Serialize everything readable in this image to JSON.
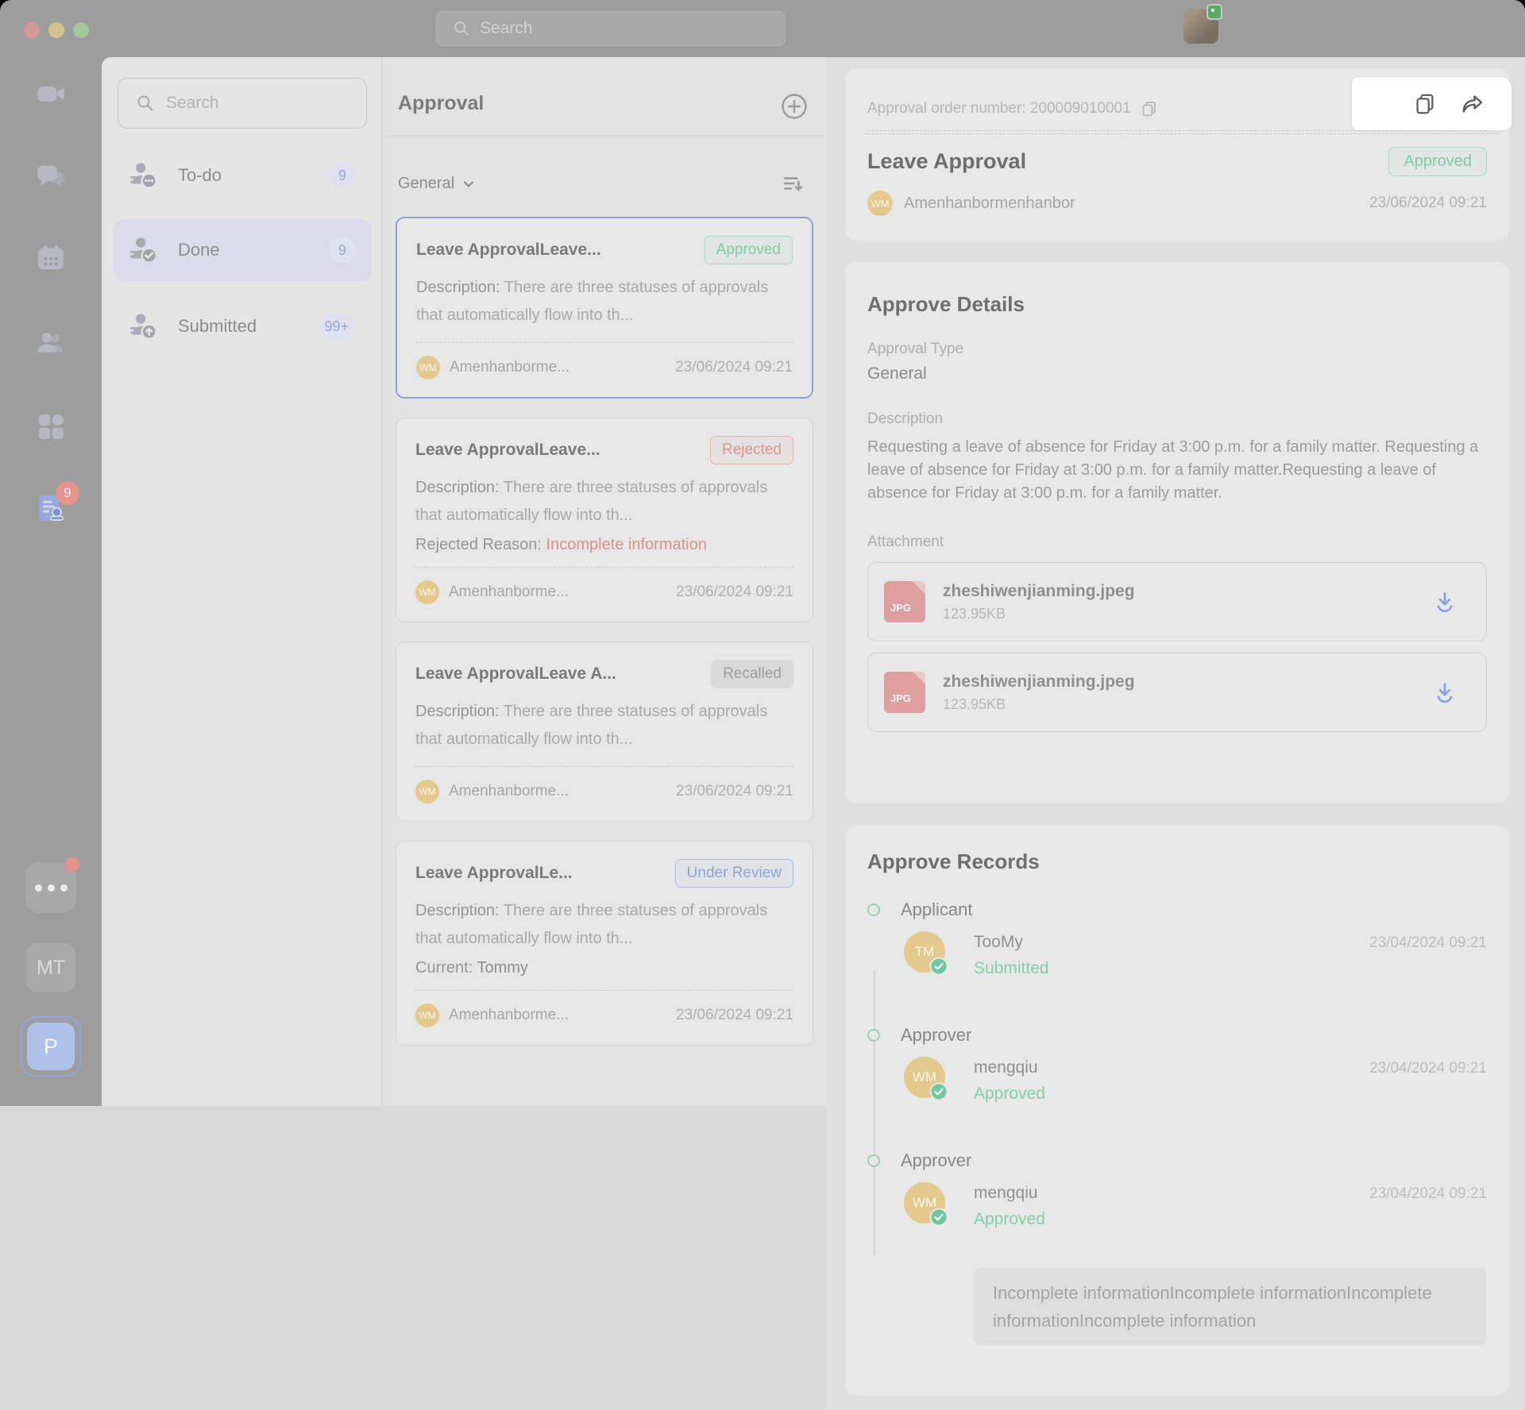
{
  "colors": {
    "status_approved_green": "#7fcda6",
    "status_rejected_red": "#db958e",
    "status_recalled_gray": "#9f9f9f",
    "status_under_review_blue": "#8da2de",
    "selected_card_blue": "#8fa0d8",
    "notification_red": "#e4938e",
    "avatar_tan": "#e4c98f",
    "timeline_green": "#97d4b3",
    "download_blue": "#8ba1e3",
    "spotlight_bg": "#ffffff"
  },
  "topbar": {
    "search_placeholder": "Search"
  },
  "rail": {
    "approval_badge": "9",
    "mt_label": "MT",
    "p_label": "P"
  },
  "sidebar": {
    "search_placeholder": "Search",
    "items": [
      {
        "label": "To-do",
        "count": "9"
      },
      {
        "label": "Done",
        "count": "9"
      },
      {
        "label": "Submitted",
        "count": "99+"
      }
    ]
  },
  "list": {
    "title": "Approval",
    "filter": "General",
    "cards": [
      {
        "title": "Leave ApprovalLeave...",
        "status": "Approved",
        "desc_label": "Description: ",
        "desc": "There are three statuses of approvals that automatically flow into th...",
        "user": "Amenhanborme...",
        "avatar": "WM",
        "time": "23/06/2024 09:21"
      },
      {
        "title": "Leave ApprovalLeave...",
        "status": "Rejected",
        "desc_label": "Description: ",
        "desc": "There are three statuses of approvals that automatically flow into th...",
        "extra_label": "Rejected Reason: ",
        "extra_value": "Incomplete information",
        "user": "Amenhanborme...",
        "avatar": "WM",
        "time": "23/06/2024 09:21"
      },
      {
        "title": "Leave ApprovalLeave A...",
        "status": "Recalled",
        "desc_label": "Description: ",
        "desc": "There are three statuses of approvals that automatically flow into th...",
        "user": "Amenhanborme...",
        "avatar": "WM",
        "time": "23/06/2024 09:21"
      },
      {
        "title": "Leave ApprovalLe...",
        "status": "Under Review",
        "desc_label": "Description: ",
        "desc": "There are three statuses of approvals that automatically flow into th...",
        "extra_label": "Current: ",
        "extra_value": "Tommy",
        "user": "Amenhanborme...",
        "avatar": "WM",
        "time": "23/06/2024 09:21"
      }
    ]
  },
  "detail": {
    "order": "Approval order number: 200009010001",
    "title": "Leave Approval",
    "status": "Approved",
    "author": "Amenhanbormenhanbor",
    "author_avatar": "WM",
    "time": "23/06/2024 09:21",
    "details": {
      "heading": "Approve Details",
      "type_label": "Approval Type",
      "type_value": "General",
      "desc_label": "Description",
      "desc": "Requesting a leave of absence for Friday at 3:00 p.m. for a family matter. Requesting a leave of absence for Friday at 3:00 p.m. for a family matter.Requesting a leave of absence for Friday at 3:00 p.m. for a family matter.",
      "attachment_label": "Attachment",
      "attachments": [
        {
          "name": "zheshiwenjianming.jpeg",
          "size": "123.95KB",
          "badge": "JPG"
        },
        {
          "name": "zheshiwenjianming.jpeg",
          "size": "123.95KB",
          "badge": "JPG"
        }
      ]
    },
    "records": {
      "heading": "Approve Records",
      "entries": [
        {
          "role": "Applicant",
          "name": "TooMy",
          "avatar": "TM",
          "status": "Submitted",
          "time": "23/04/2024 09:21"
        },
        {
          "role": "Approver",
          "name": "mengqiu",
          "avatar": "WM",
          "status": "Approved",
          "time": "23/04/2024 09:21"
        },
        {
          "role": "Approver",
          "name": "mengqiu",
          "avatar": "WM",
          "status": "Approved",
          "time": "23/04/2024 09:21",
          "comment": "Incomplete informationIncomplete informationIncomplete informationIncomplete information"
        }
      ]
    }
  }
}
